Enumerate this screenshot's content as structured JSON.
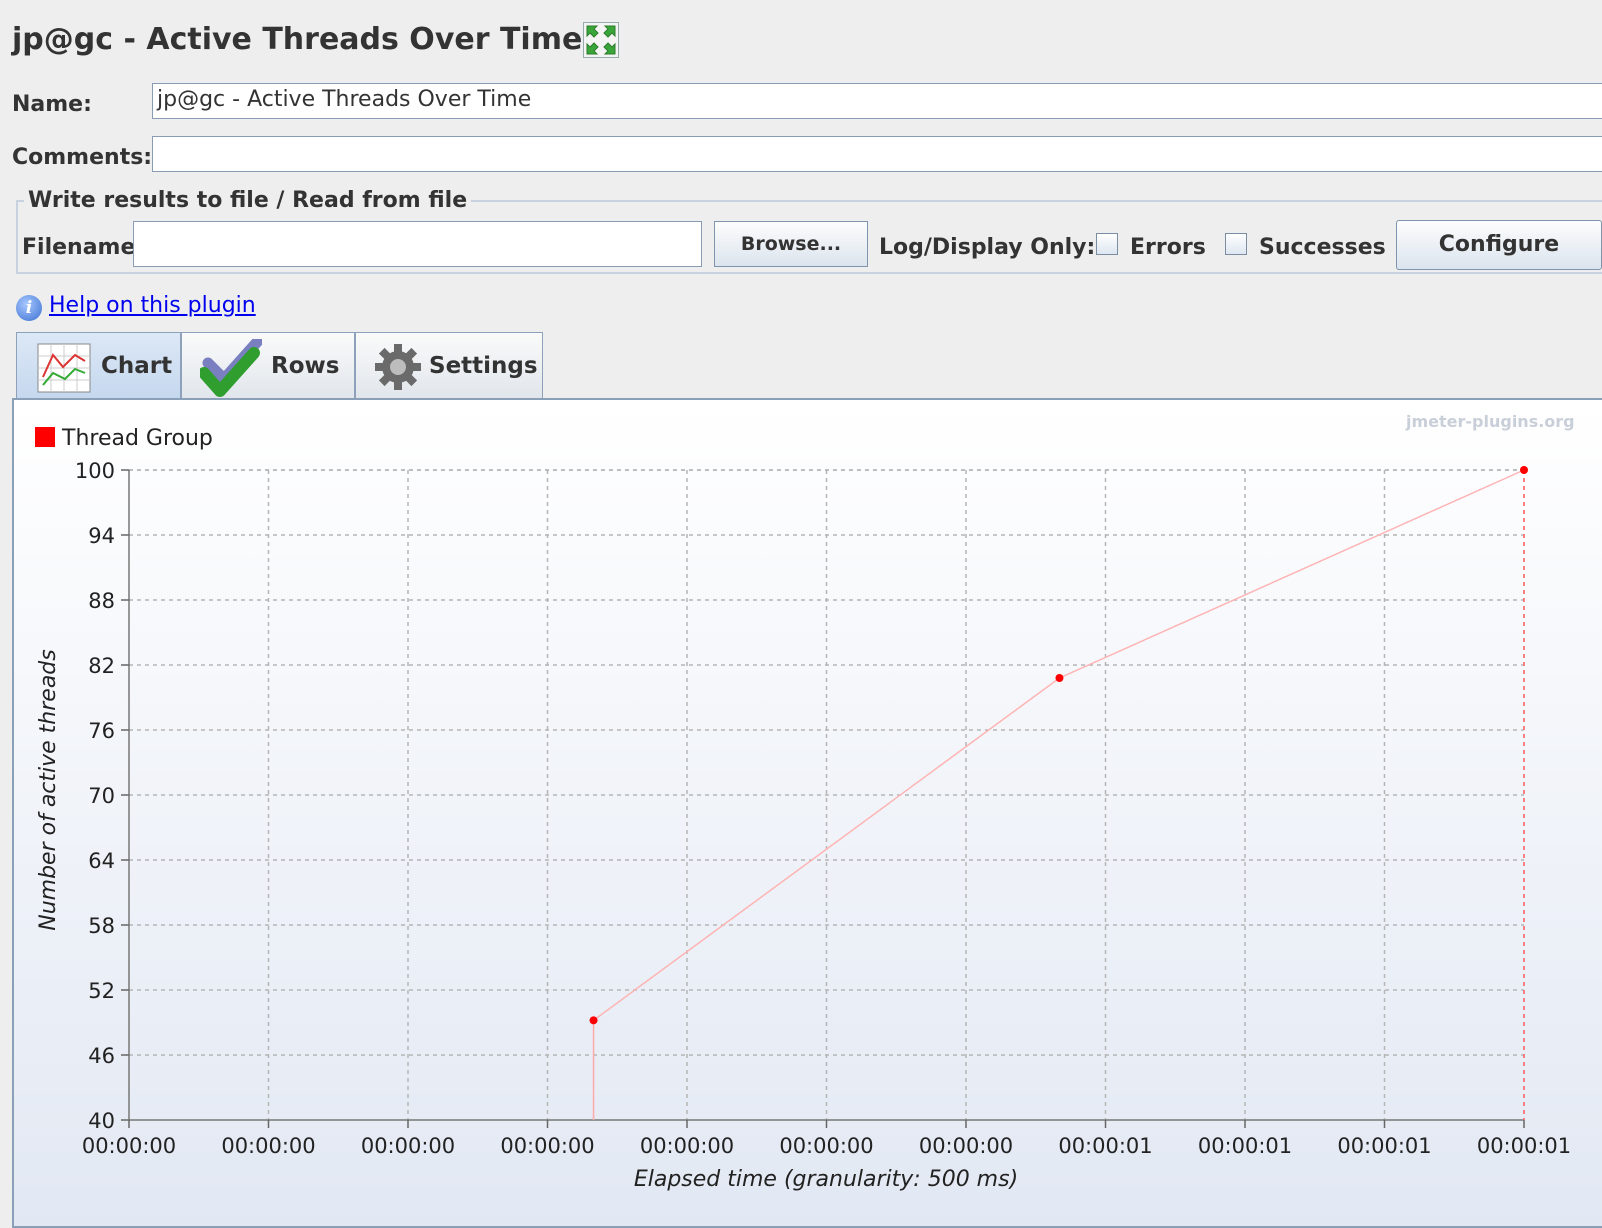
{
  "panel": {
    "title": "jp@gc - Active Threads Over Time",
    "expand_icon": "expand-arrows-icon"
  },
  "form": {
    "name_label": "Name:",
    "name_value": "jp@gc - Active Threads Over Time",
    "comments_label": "Comments:",
    "comments_value": ""
  },
  "file_section": {
    "title": "Write results to file / Read from file",
    "filename_label": "Filename",
    "filename_value": "",
    "browse_label": "Browse...",
    "log_display_label": "Log/Display Only:",
    "errors_label": "Errors",
    "errors_checked": false,
    "successes_label": "Successes",
    "successes_checked": false,
    "configure_label": "Configure"
  },
  "help": {
    "icon": "info-icon",
    "link_text": "Help on this plugin"
  },
  "tabs": [
    {
      "label": "Chart",
      "icon": "line-chart-icon",
      "active": true
    },
    {
      "label": "Rows",
      "icon": "checkmark-icon",
      "active": false
    },
    {
      "label": "Settings",
      "icon": "gear-icon",
      "active": false
    }
  ],
  "chart_data": {
    "type": "line",
    "watermark": "jmeter-plugins.org",
    "series": [
      {
        "name": "Thread Group",
        "color": "#ff0000",
        "points": [
          {
            "x": 0.333,
            "y": 49.2
          },
          {
            "x": 0.667,
            "y": 80.8
          },
          {
            "x": 1.0,
            "y": 100
          }
        ]
      }
    ],
    "xlabel": "Elapsed time (granularity: 500 ms)",
    "ylabel": "Number of active threads",
    "xlim": [
      0,
      1.0
    ],
    "ylim": [
      40,
      100
    ],
    "y_ticks": [
      "40",
      "46",
      "52",
      "58",
      "64",
      "70",
      "76",
      "82",
      "88",
      "94",
      "100"
    ],
    "x_ticks": [
      "00:00:00",
      "00:00:00",
      "00:00:00",
      "00:00:00",
      "00:00:00",
      "00:00:00",
      "00:00:00",
      "00:00:01",
      "00:00:01",
      "00:00:01",
      "00:00:01"
    ],
    "grid": true,
    "legend_position": "top-left"
  }
}
